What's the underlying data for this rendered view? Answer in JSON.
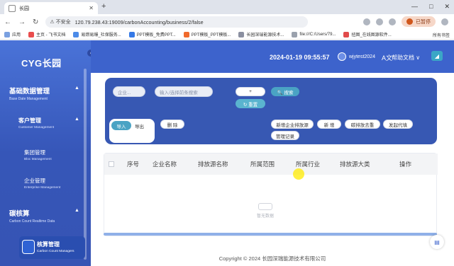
{
  "browser": {
    "tab_title": "长园",
    "new_tab": "+",
    "window_controls": [
      "—",
      "□",
      "✕"
    ],
    "nav": [
      "←",
      "→",
      "↻"
    ],
    "security": "⚠ 不安全",
    "url": "120.79.238.43:19009/carbonAccounting/business/2/false",
    "pause_label": "已暂停",
    "bookmarks": [
      "应用",
      "主页 - 飞书文档",
      "易燃易爆_社保服务...",
      "PPT模板_免费PPT...",
      "PPT模板_PPT模板...",
      "长园深瑞能源技术...",
      "file:///C:/Users/79...",
      "扭图_在线图源软件..."
    ],
    "all_bookmarks": "所有书签",
    "colors": {
      "tab_strip": "#dfe3eb"
    }
  },
  "sidebar": {
    "logo": "CYG长园",
    "collapse_icon": "‹",
    "groups": [
      {
        "title": "基础数据管理",
        "subtitle": "Base Date Management",
        "arrow": "▲"
      },
      {
        "title": "碳核算",
        "subtitle": "Carbon Count Realtime Data",
        "arrow": "▲"
      }
    ],
    "submenu": {
      "title": "客户管理",
      "subtitle": "Customer Management",
      "arrow": "▲"
    },
    "items": [
      {
        "title": "集团管理",
        "subtitle": "Bloc Management"
      },
      {
        "title": "企业管理",
        "subtitle": "Enterprise Management"
      }
    ],
    "active_item": {
      "title": "核算管理",
      "subtitle": "Carbon Count Managers",
      "icon": "document-icon"
    },
    "colors": {
      "bg": "#3d63cc",
      "active": "#2a4eb0"
    }
  },
  "header": {
    "datetime": "2024-01-19 09:55:57",
    "username": "wjytest2024",
    "lang_icon": "A文",
    "help": "帮助文档 ∨",
    "corner_icon": "◢"
  },
  "filters": {
    "enterprise_placeholder": "企业...",
    "input_placeholder": "输入/选择前条搜索",
    "add": "+",
    "search": "🔍 搜索",
    "reset": "↻ 重置",
    "import": "导入",
    "export": "导出",
    "delete": "删 除",
    "actions": [
      "新增企业排放源",
      "新 增",
      "碳排放去重",
      "发起代填",
      "管理记录"
    ]
  },
  "table": {
    "columns": [
      "序号",
      "企业名称",
      "排放源名称",
      "所属范围",
      "所属行业",
      "排放源大类",
      "操作"
    ],
    "empty_text": "暂无数据"
  },
  "footer": "Copyright © 2024 长园深瑞能源技术有限公司",
  "fab_icon": "document-icon"
}
